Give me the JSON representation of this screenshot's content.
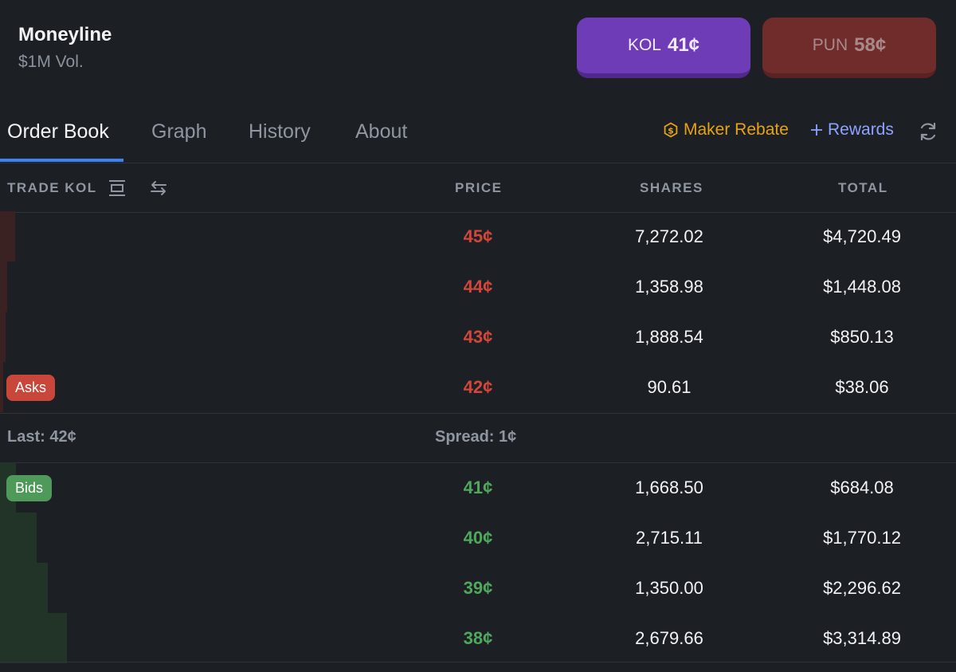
{
  "header": {
    "title": "Moneyline",
    "volume": "$1M Vol."
  },
  "buttons": {
    "kol": {
      "label": "KOL",
      "price": "41¢",
      "color": "#6f3cb8"
    },
    "pun": {
      "label": "PUN",
      "price": "58¢",
      "color": "#702b2b"
    }
  },
  "tabs": [
    {
      "label": "Order Book",
      "active": true
    },
    {
      "label": "Graph",
      "active": false
    },
    {
      "label": "History",
      "active": false
    },
    {
      "label": "About",
      "active": false
    }
  ],
  "maker_rebate": {
    "label": "Maker Rebate",
    "icon": "dollar-circle-icon",
    "color": "#e7a317"
  },
  "rewards": {
    "label": "Rewards",
    "icon": "plus-icon",
    "color": "#8fa2ff"
  },
  "columns": {
    "trade": "TRADE KOL",
    "price": "PRICE",
    "shares": "SHARES",
    "total": "TOTAL"
  },
  "asks": [
    {
      "price": "45¢",
      "shares": "7,272.02",
      "total": "$4,720.49"
    },
    {
      "price": "44¢",
      "shares": "1,358.98",
      "total": "$1,448.08"
    },
    {
      "price": "43¢",
      "shares": "1,888.54",
      "total": "$850.13"
    },
    {
      "price": "42¢",
      "shares": "90.61",
      "total": "$38.06"
    }
  ],
  "asks_badge": "Asks",
  "last": "Last: 42¢",
  "spread": "Spread: 1¢",
  "bids_badge": "Bids",
  "bids": [
    {
      "price": "41¢",
      "shares": "1,668.50",
      "total": "$684.08"
    },
    {
      "price": "40¢",
      "shares": "2,715.11",
      "total": "$1,770.12"
    },
    {
      "price": "39¢",
      "shares": "1,350.00",
      "total": "$2,296.62"
    },
    {
      "price": "38¢",
      "shares": "2,679.66",
      "total": "$3,314.89"
    }
  ],
  "colors": {
    "ask": "#d2473a",
    "bid": "#4fa85c",
    "accent": "#3a82f6"
  }
}
